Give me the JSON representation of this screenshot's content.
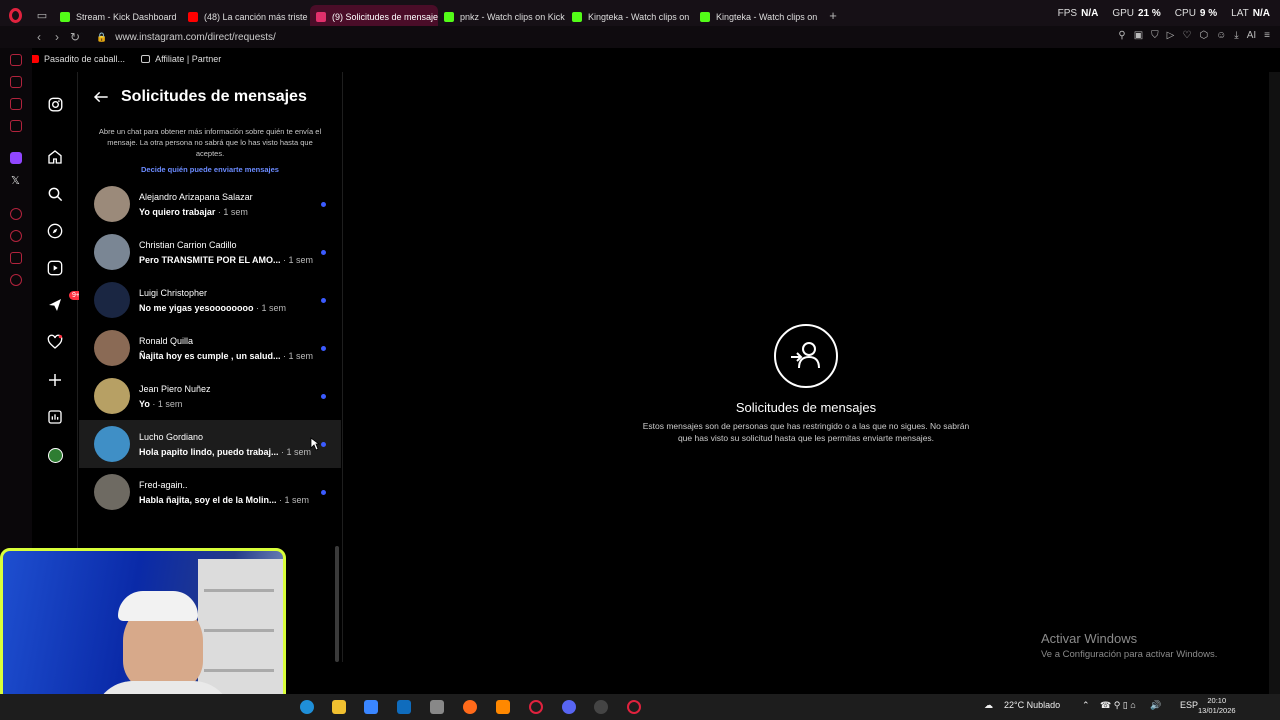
{
  "browser": {
    "tabs": [
      {
        "label": "Stream - Kick Dashboard",
        "fav": "kick-icon",
        "color": "#53fc18",
        "active": false
      },
      {
        "label": "(48) La canción más triste",
        "fav": "youtube-icon",
        "color": "#ff0000",
        "active": false
      },
      {
        "label": "(9) Solicitudes de mensaje",
        "fav": "instagram-icon",
        "color": "#e1306c",
        "active": true
      },
      {
        "label": "pnkz - Watch clips on Kick",
        "fav": "kick-icon",
        "color": "#53fc18",
        "active": false
      },
      {
        "label": "Kingteka - Watch clips on",
        "fav": "kick-icon",
        "color": "#53fc18",
        "active": false
      },
      {
        "label": "Kingteka - Watch clips on",
        "fav": "kick-icon",
        "color": "#53fc18",
        "active": false
      }
    ],
    "hw_stats": [
      {
        "label": "FPS",
        "value": "N/A"
      },
      {
        "label": "GPU",
        "value": "21 %"
      },
      {
        "label": "CPU",
        "value": "9 %"
      },
      {
        "label": "LAT",
        "value": "N/A"
      }
    ],
    "url": "www.instagram.com/direct/requests/",
    "bookmarks": [
      "Pasadito de caball...",
      "Affiliate | Partner"
    ]
  },
  "requests": {
    "title": "Solicitudes de mensajes",
    "info": "Abre un chat para obtener más información sobre quién te envía el mensaje. La otra persona no sabrá que lo has visto hasta que aceptes.",
    "link": "Decide quién puede enviarte mensajes",
    "items": [
      {
        "name": "Alejandro Arizapana Salazar",
        "message": "Yo quiero trabajar",
        "time": " · 1 sem",
        "avatar": "#9b8a7a"
      },
      {
        "name": "Christian Carrion Cadillo",
        "message": "Pero TRANSMITE POR EL AMO...",
        "time": " · 1 sem",
        "avatar": "#7a8694"
      },
      {
        "name": "Luigi Christopher",
        "message": "No me yigas yesoooooooo",
        "time": " · 1 sem",
        "avatar": "#1a2642"
      },
      {
        "name": "Ronald Quilla",
        "message": "Ñajita hoy es cumple , un salud...",
        "time": " · 1 sem",
        "avatar": "#8a6a55"
      },
      {
        "name": "Jean Piero Nuñez",
        "message": "Yo",
        "time": " · 1 sem",
        "avatar": "#b7a064"
      },
      {
        "name": "Lucho Gordiano",
        "message": "Hola papito lindo, puedo trabaj...",
        "time": " · 1 sem",
        "avatar": "#3f8fc6"
      },
      {
        "name": "Fred-again..",
        "message": "Habla ñajita, soy el de la Molin...",
        "time": " · 1 sem",
        "avatar": "#6e6a62"
      }
    ]
  },
  "empty_state": {
    "title": "Solicitudes de mensajes",
    "description": "Estos mensajes son de personas que has restringido o a las que no sigues. No sabrán que has visto su solicitud hasta que les permitas enviarte mensajes."
  },
  "nav_badge": "9+",
  "watermark": {
    "title": "Activar Windows",
    "subtitle": "Ve a Configuración para activar Windows."
  },
  "taskbar": {
    "weather": "22°C  Nublado",
    "lang": "ESP",
    "time": "20:10",
    "date": "13/01/2026"
  }
}
